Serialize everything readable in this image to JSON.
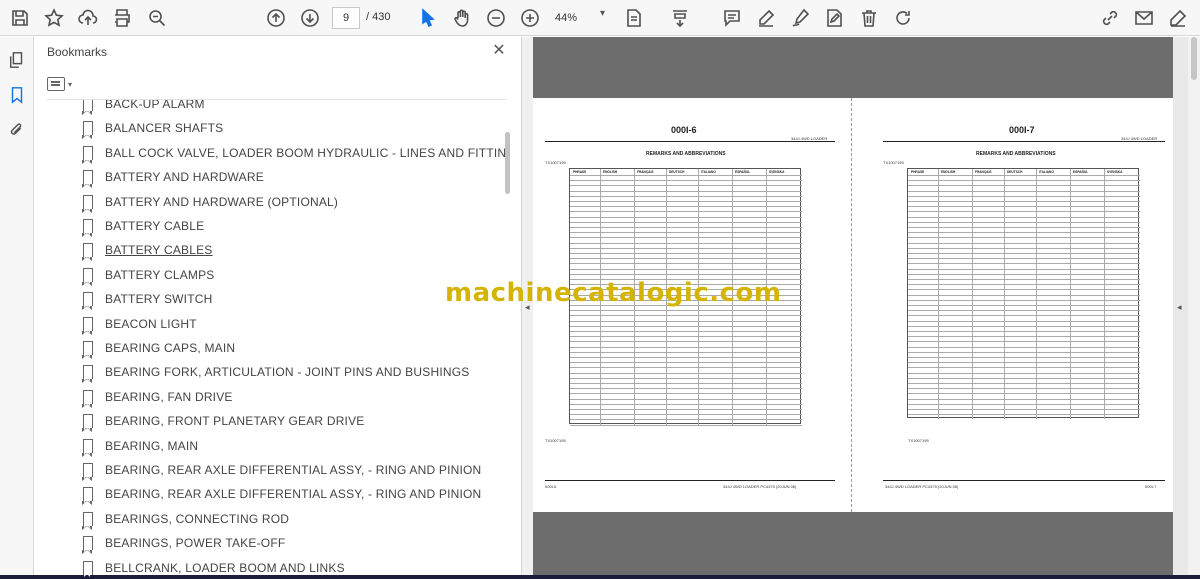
{
  "toolbar": {
    "page_current": "9",
    "page_total": "/ 430",
    "zoom": "44%"
  },
  "panel": {
    "title": "Bookmarks",
    "close": "✕"
  },
  "bookmarks": [
    {
      "label": "BACK-UP ALARM"
    },
    {
      "label": "BALANCER SHAFTS"
    },
    {
      "label": "BALL COCK VALVE, LOADER BOOM HYDRAULIC - LINES AND FITTINGS"
    },
    {
      "label": "BATTERY AND HARDWARE"
    },
    {
      "label": "BATTERY AND HARDWARE (OPTIONAL)"
    },
    {
      "label": "BATTERY CABLE"
    },
    {
      "label": "BATTERY CABLES"
    },
    {
      "label": "BATTERY CLAMPS"
    },
    {
      "label": "BATTERY SWITCH"
    },
    {
      "label": "BEACON LIGHT"
    },
    {
      "label": "BEARING CAPS, MAIN"
    },
    {
      "label": "BEARING FORK, ARTICULATION - JOINT PINS AND BUSHINGS"
    },
    {
      "label": "BEARING, FAN DRIVE"
    },
    {
      "label": "BEARING, FRONT PLANETARY GEAR DRIVE"
    },
    {
      "label": "BEARING, MAIN"
    },
    {
      "label": "BEARING, REAR AXLE DIFFERENTIAL ASSY, - RING AND PINION"
    },
    {
      "label": "BEARING, REAR AXLE DIFFERENTIAL ASSY, - RING AND PINION"
    },
    {
      "label": "BEARINGS, CONNECTING ROD"
    },
    {
      "label": "BEARINGS, POWER TAKE-OFF"
    },
    {
      "label": "BELLCRANK, LOADER BOOM AND LINKS"
    }
  ],
  "document": {
    "left_page": {
      "header": "000I-6",
      "header_right": "344J 4WD LOADER",
      "remarks_title": "REMARKS AND ABBREVIATIONS",
      "tx_code": "TX1007195",
      "footer_left": "000I-6",
      "footer_right": "344J 4WD LOADER   PC4375   (20JUN 06)",
      "columns": [
        "PHRASE",
        "ENGLISH",
        "FRANÇAIS",
        "DEUTSCH",
        "ITALIANO",
        "ESPAÑOL",
        "SVENSKA"
      ]
    },
    "right_page": {
      "header": "000I-7",
      "header_right": "344J 4WD LOADER",
      "remarks_title": "REMARKS AND ABBREVIATIONS",
      "tx_code": "TX1007195",
      "footer_left": "344J 4WD LOADER   PC4375   (20JUN 06)",
      "footer_right": "000I-7",
      "columns": [
        "PHRASE",
        "ENGLISH",
        "FRANÇAIS",
        "DEUTSCH",
        "ITALIANO",
        "ESPAÑOL",
        "SVENSKA"
      ]
    },
    "watermark": "machinecatalogic.com"
  }
}
